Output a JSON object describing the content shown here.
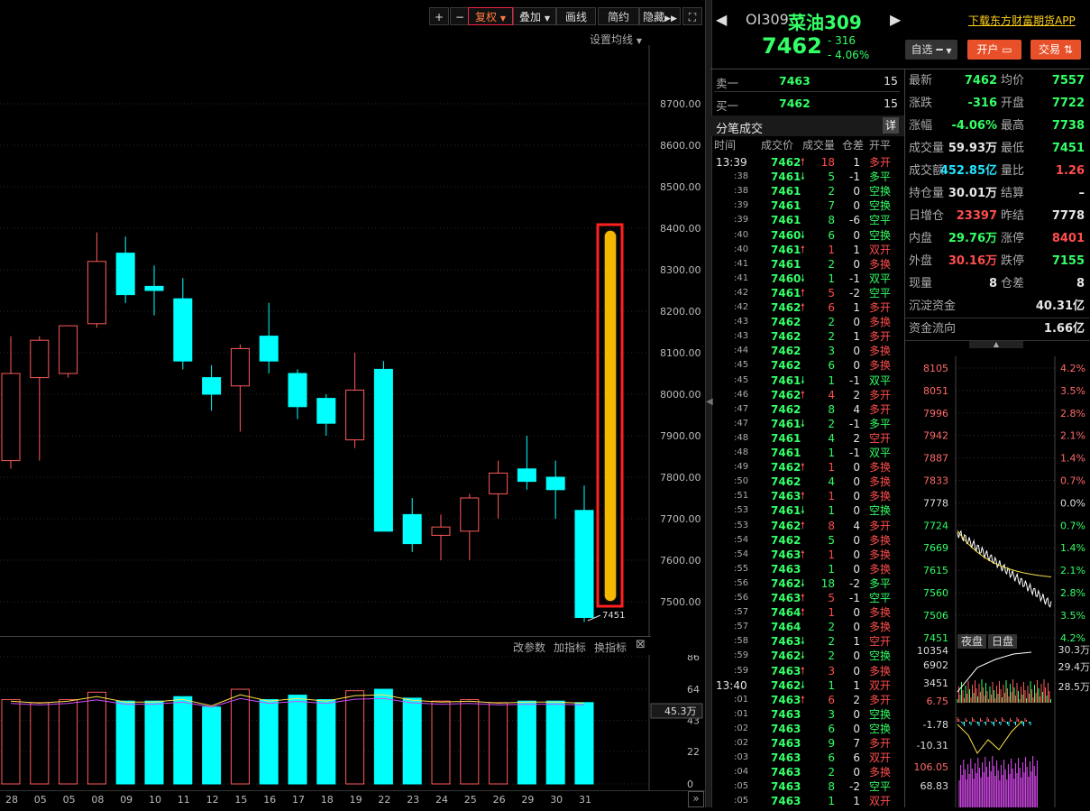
{
  "toolbar": {
    "plus": "+",
    "minus": "−",
    "buttons": [
      "复权",
      "叠加",
      "画线",
      "简约",
      "隐藏"
    ],
    "expand_icon": "expand-icon",
    "set_ma": "设置均线"
  },
  "chart_data": [
    {
      "type": "candlestick",
      "title": "",
      "ylabel": "",
      "yticks": [
        8700,
        8600,
        8500,
        8400,
        8300,
        8200,
        8100,
        8000,
        7900,
        7800,
        7700,
        7600,
        7500
      ],
      "ytick_labels": [
        "8700.00",
        "8600.00",
        "8500.00",
        "8400.00",
        "8300.00",
        "8200.00",
        "8100.00",
        "8000.00",
        "7900.00",
        "7800.00",
        "7700.00",
        "7600.00",
        "7500.00"
      ],
      "ylim": [
        7400,
        8850
      ],
      "categories": [
        "28",
        "05",
        "05",
        "08",
        "09",
        "10",
        "11",
        "12",
        "15",
        "16",
        "17",
        "18",
        "19",
        "22",
        "23",
        "24",
        "25",
        "26",
        "29",
        "30",
        "31"
      ],
      "candles": [
        {
          "o": 7840,
          "h": 8140,
          "l": 7820,
          "c": 8050
        },
        {
          "o": 8040,
          "h": 8140,
          "l": 7840,
          "c": 8130
        },
        {
          "o": 8050,
          "h": 8160,
          "l": 8040,
          "c": 8165
        },
        {
          "o": 8170,
          "h": 8390,
          "l": 8160,
          "c": 8320
        },
        {
          "o": 8340,
          "h": 8380,
          "l": 8220,
          "c": 8240
        },
        {
          "o": 8260,
          "h": 8310,
          "l": 8190,
          "c": 8250
        },
        {
          "o": 8230,
          "h": 8280,
          "l": 8060,
          "c": 8080
        },
        {
          "o": 8040,
          "h": 8070,
          "l": 7960,
          "c": 8000
        },
        {
          "o": 8020,
          "h": 8120,
          "l": 7910,
          "c": 8110
        },
        {
          "o": 8140,
          "h": 8220,
          "l": 8050,
          "c": 8080
        },
        {
          "o": 8050,
          "h": 8060,
          "l": 7940,
          "c": 7970
        },
        {
          "o": 7990,
          "h": 8000,
          "l": 7900,
          "c": 7930
        },
        {
          "o": 7890,
          "h": 8100,
          "l": 7870,
          "c": 8010
        },
        {
          "o": 8060,
          "h": 8080,
          "l": 7670,
          "c": 7670
        },
        {
          "o": 7710,
          "h": 7750,
          "l": 7620,
          "c": 7640
        },
        {
          "o": 7660,
          "h": 7710,
          "l": 7600,
          "c": 7680
        },
        {
          "o": 7670,
          "h": 7760,
          "l": 7600,
          "c": 7750
        },
        {
          "o": 7760,
          "h": 7840,
          "l": 7700,
          "c": 7810
        },
        {
          "o": 7820,
          "h": 7900,
          "l": 7770,
          "c": 7790
        },
        {
          "o": 7800,
          "h": 7840,
          "l": 7700,
          "c": 7770
        },
        {
          "o": 7720,
          "h": 7780,
          "l": 7451,
          "c": 7462
        }
      ],
      "low_label": "7451",
      "highlight": {
        "from": 8390,
        "to": 7510
      }
    },
    {
      "type": "bar",
      "title": "",
      "yticks": [
        "86",
        "64",
        "43",
        "22",
        "0"
      ],
      "ylim": [
        0,
        86
      ],
      "last_value_label": "45.3万",
      "values": [
        57,
        55,
        57,
        62,
        56,
        56,
        59,
        52,
        64,
        57,
        60,
        57,
        63,
        64,
        58,
        56,
        57,
        55,
        56,
        56,
        55
      ]
    }
  ],
  "indicator_bar": {
    "modify": "改参数",
    "add": "加指标",
    "switch": "换指标",
    "close": "⊠"
  },
  "bottom_dates_scroll": "»",
  "quote": {
    "code": "OI309",
    "name": "菜油309",
    "price": "7462",
    "change": "- 316",
    "change_pct": "- 4.06%",
    "download": "下载东方财富期货APP",
    "watch_btn": "自选",
    "open_btn": "开户",
    "trade_btn": "交易"
  },
  "orderbook": [
    {
      "label": "卖一",
      "price": "7463",
      "vol": "15"
    },
    {
      "label": "买一",
      "price": "7462",
      "vol": "15"
    }
  ],
  "ticks_header": {
    "title": "分笔成交",
    "detail": "详",
    "cols": [
      "时间",
      "成交价",
      "成交量",
      "仓差",
      "开平"
    ]
  },
  "ticks": [
    {
      "t": "13:39",
      "p": "7462",
      "a": "up",
      "v": "18",
      "d": "1",
      "k": "多开"
    },
    {
      "t": ":38",
      "p": "7461",
      "a": "down",
      "v": "5",
      "d": "-1",
      "k": "多平"
    },
    {
      "t": ":38",
      "p": "7461",
      "a": "",
      "v": "2",
      "d": "0",
      "k": "空换"
    },
    {
      "t": ":39",
      "p": "7461",
      "a": "",
      "v": "7",
      "d": "0",
      "k": "空换"
    },
    {
      "t": ":39",
      "p": "7461",
      "a": "",
      "v": "8",
      "d": "-6",
      "k": "空平"
    },
    {
      "t": ":40",
      "p": "7460",
      "a": "down",
      "v": "6",
      "d": "0",
      "k": "空换"
    },
    {
      "t": ":40",
      "p": "7461",
      "a": "up",
      "v": "1",
      "d": "1",
      "k": "双开"
    },
    {
      "t": ":41",
      "p": "7461",
      "a": "",
      "v": "2",
      "d": "0",
      "k": "多换"
    },
    {
      "t": ":41",
      "p": "7460",
      "a": "down",
      "v": "1",
      "d": "-1",
      "k": "双平"
    },
    {
      "t": ":42",
      "p": "7461",
      "a": "up",
      "v": "5",
      "d": "-2",
      "k": "空平"
    },
    {
      "t": ":42",
      "p": "7462",
      "a": "up",
      "v": "6",
      "d": "1",
      "k": "多开"
    },
    {
      "t": ":43",
      "p": "7462",
      "a": "",
      "v": "2",
      "d": "0",
      "k": "多换"
    },
    {
      "t": ":43",
      "p": "7462",
      "a": "",
      "v": "2",
      "d": "1",
      "k": "多开"
    },
    {
      "t": ":44",
      "p": "7462",
      "a": "",
      "v": "3",
      "d": "0",
      "k": "多换"
    },
    {
      "t": ":45",
      "p": "7462",
      "a": "",
      "v": "6",
      "d": "0",
      "k": "多换"
    },
    {
      "t": ":45",
      "p": "7461",
      "a": "down",
      "v": "1",
      "d": "-1",
      "k": "双平"
    },
    {
      "t": ":46",
      "p": "7462",
      "a": "up",
      "v": "4",
      "d": "2",
      "k": "多开"
    },
    {
      "t": ":47",
      "p": "7462",
      "a": "",
      "v": "8",
      "d": "4",
      "k": "多开"
    },
    {
      "t": ":47",
      "p": "7461",
      "a": "down",
      "v": "2",
      "d": "-1",
      "k": "多平"
    },
    {
      "t": ":48",
      "p": "7461",
      "a": "",
      "v": "4",
      "d": "2",
      "k": "空开"
    },
    {
      "t": ":48",
      "p": "7461",
      "a": "",
      "v": "1",
      "d": "-1",
      "k": "双平"
    },
    {
      "t": ":49",
      "p": "7462",
      "a": "up",
      "v": "1",
      "d": "0",
      "k": "多换"
    },
    {
      "t": ":50",
      "p": "7462",
      "a": "",
      "v": "4",
      "d": "0",
      "k": "多换"
    },
    {
      "t": ":51",
      "p": "7463",
      "a": "up",
      "v": "1",
      "d": "0",
      "k": "多换"
    },
    {
      "t": ":53",
      "p": "7461",
      "a": "down",
      "v": "1",
      "d": "0",
      "k": "空换"
    },
    {
      "t": ":53",
      "p": "7462",
      "a": "up",
      "v": "8",
      "d": "4",
      "k": "多开"
    },
    {
      "t": ":54",
      "p": "7462",
      "a": "",
      "v": "5",
      "d": "0",
      "k": "多换"
    },
    {
      "t": ":54",
      "p": "7463",
      "a": "up",
      "v": "1",
      "d": "0",
      "k": "多换"
    },
    {
      "t": ":55",
      "p": "7463",
      "a": "",
      "v": "1",
      "d": "0",
      "k": "多换"
    },
    {
      "t": ":56",
      "p": "7462",
      "a": "down",
      "v": "18",
      "d": "-2",
      "k": "多平"
    },
    {
      "t": ":56",
      "p": "7463",
      "a": "up",
      "v": "5",
      "d": "-1",
      "k": "空平"
    },
    {
      "t": ":57",
      "p": "7464",
      "a": "up",
      "v": "1",
      "d": "0",
      "k": "多换"
    },
    {
      "t": ":57",
      "p": "7464",
      "a": "",
      "v": "2",
      "d": "0",
      "k": "多换"
    },
    {
      "t": ":58",
      "p": "7463",
      "a": "down",
      "v": "2",
      "d": "1",
      "k": "空开"
    },
    {
      "t": ":59",
      "p": "7462",
      "a": "down",
      "v": "2",
      "d": "0",
      "k": "空换"
    },
    {
      "t": ":59",
      "p": "7463",
      "a": "up",
      "v": "3",
      "d": "0",
      "k": "多换"
    },
    {
      "t": "13:40",
      "p": "7462",
      "a": "down",
      "v": "1",
      "d": "1",
      "k": "双开"
    },
    {
      "t": ":01",
      "p": "7463",
      "a": "up",
      "v": "6",
      "d": "2",
      "k": "多开"
    },
    {
      "t": ":01",
      "p": "7463",
      "a": "",
      "v": "3",
      "d": "0",
      "k": "空换"
    },
    {
      "t": ":02",
      "p": "7463",
      "a": "",
      "v": "6",
      "d": "0",
      "k": "空换"
    },
    {
      "t": ":02",
      "p": "7463",
      "a": "",
      "v": "9",
      "d": "7",
      "k": "多开"
    },
    {
      "t": ":03",
      "p": "7463",
      "a": "",
      "v": "6",
      "d": "6",
      "k": "双开"
    },
    {
      "t": ":04",
      "p": "7463",
      "a": "",
      "v": "2",
      "d": "0",
      "k": "多换"
    },
    {
      "t": ":05",
      "p": "7463",
      "a": "",
      "v": "8",
      "d": "-2",
      "k": "空平"
    },
    {
      "t": ":05",
      "p": "7463",
      "a": "",
      "v": "1",
      "d": "1",
      "k": "双开"
    }
  ],
  "stats": [
    [
      {
        "l": "最新",
        "v": "7462",
        "c": "green"
      },
      {
        "l": "均价",
        "v": "7557",
        "c": "green"
      }
    ],
    [
      {
        "l": "涨跌",
        "v": "-316",
        "c": "green"
      },
      {
        "l": "开盘",
        "v": "7722",
        "c": "green"
      }
    ],
    [
      {
        "l": "涨幅",
        "v": "-4.06%",
        "c": "green"
      },
      {
        "l": "最高",
        "v": "7738",
        "c": "green"
      }
    ],
    [
      {
        "l": "成交量",
        "v": "59.93万",
        "c": "white"
      },
      {
        "l": "最低",
        "v": "7451",
        "c": "green"
      }
    ],
    [
      {
        "l": "成交额",
        "v": "452.85亿",
        "c": "cyan"
      },
      {
        "l": "量比",
        "v": "1.26",
        "c": "red"
      }
    ],
    [
      {
        "l": "持仓量",
        "v": "30.01万",
        "c": "white"
      },
      {
        "l": "结算",
        "v": "–",
        "c": "white"
      }
    ],
    [
      {
        "l": "日增仓",
        "v": "23397",
        "c": "red"
      },
      {
        "l": "昨结",
        "v": "7778",
        "c": "white"
      }
    ],
    [
      {
        "l": "内盘",
        "v": "29.76万",
        "c": "green"
      },
      {
        "l": "涨停",
        "v": "8401",
        "c": "red"
      }
    ],
    [
      {
        "l": "外盘",
        "v": "30.16万",
        "c": "red"
      },
      {
        "l": "跌停",
        "v": "7155",
        "c": "green"
      }
    ],
    [
      {
        "l": "现量",
        "v": "8",
        "c": "white"
      },
      {
        "l": "仓差",
        "v": "8",
        "c": "white"
      }
    ],
    [
      {
        "l": "沉淀资金",
        "v": "40.31亿",
        "c": "white"
      }
    ],
    [
      {
        "l": "资金流向",
        "v": "1.66亿",
        "c": "white"
      }
    ]
  ],
  "mini_chart": {
    "left_labels": [
      "8105",
      "8051",
      "7996",
      "7942",
      "7887",
      "7833",
      "7778",
      "7724",
      "7669",
      "7615",
      "7560",
      "7506",
      "7451"
    ],
    "right_labels": [
      "4.2%",
      "3.5%",
      "2.8%",
      "2.1%",
      "1.4%",
      "0.7%",
      "0.0%",
      "0.7%",
      "1.4%",
      "2.1%",
      "2.8%",
      "3.5%",
      "4.2%"
    ],
    "night_btn": "夜盘",
    "day_btn": "日盘",
    "vol_left": [
      "10354",
      "6902",
      "3451",
      "6.75"
    ],
    "vol_right": [
      "30.3万",
      "29.4万",
      "28.5万"
    ],
    "macd_left": [
      "-1.78",
      "-10.31"
    ],
    "kdj_left": [
      "106.05",
      "68.83"
    ]
  }
}
